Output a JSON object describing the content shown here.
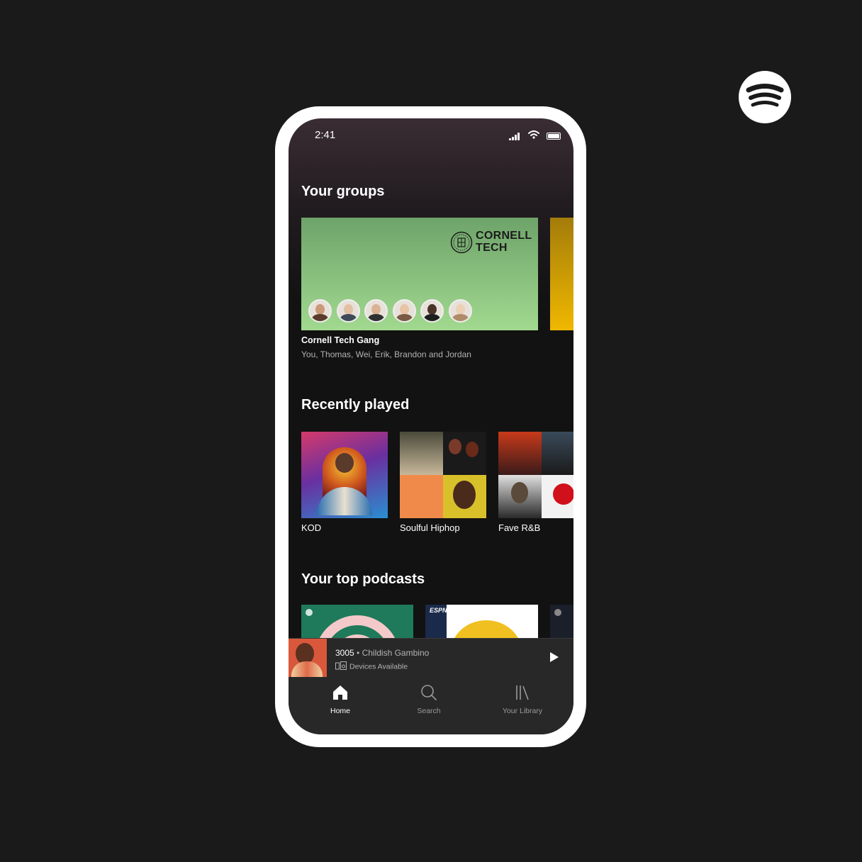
{
  "status_bar": {
    "time": "2:41"
  },
  "sections": {
    "groups_title": "Your groups",
    "recent_title": "Recently played",
    "podcasts_title": "Your top podcasts"
  },
  "group": {
    "org_line1": "CORNELL",
    "org_line2": "TECH",
    "name": "Cornell Tech Gang",
    "members": "You, Thomas, Wei, Erik, Brandon and Jordan"
  },
  "recently_played": [
    {
      "label": "KOD"
    },
    {
      "label": "Soulful Hiphop"
    },
    {
      "label": "Fave R&B"
    }
  ],
  "podcasts": [
    {
      "badge": ""
    },
    {
      "badge": "ESPN"
    },
    {
      "badge": ""
    }
  ],
  "now_playing": {
    "track": "3005",
    "separator": " • ",
    "artist": "Childish Gambino",
    "devices": "Devices Available"
  },
  "tabs": [
    {
      "label": "Home",
      "icon": "home-icon",
      "active": true
    },
    {
      "label": "Search",
      "icon": "search-icon",
      "active": false
    },
    {
      "label": "Your Library",
      "icon": "library-icon",
      "active": false
    }
  ],
  "colors": {
    "background": "#1a1a1a",
    "group_card_top": "#6ea36a",
    "group_card_bottom": "#a2d98f",
    "second_card": "#f0b800",
    "tab_bar": "#282828"
  }
}
